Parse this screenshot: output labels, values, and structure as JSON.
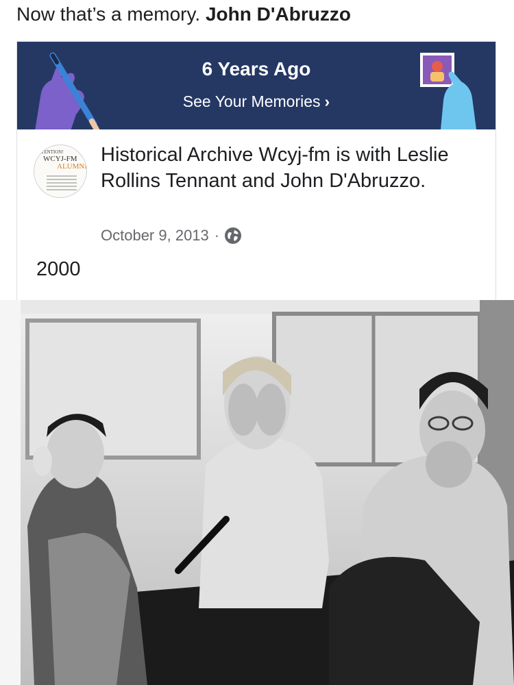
{
  "caption": {
    "text": "Now that’s a memory.",
    "mention": "John D'Abruzzo"
  },
  "memory_banner": {
    "title": "6 Years Ago",
    "link": "See Your Memories",
    "link_chevron": "›",
    "background": "#253864"
  },
  "post": {
    "page_name": "Historical Archive Wcyj-fm",
    "is_with": "is with",
    "tagged_1": "Leslie Rollins Tennant",
    "and": "and",
    "tagged_2": "John D'Abruzzo",
    "period": ".",
    "date": "October 9, 2013",
    "separator": "·",
    "privacy_icon": "globe-icon",
    "body": "2000",
    "avatar": {
      "line1": "TENTION!",
      "line2": "WCYJ-FM",
      "line3": "ALUMNI"
    }
  },
  "photo": {
    "icon": "photo-image"
  }
}
